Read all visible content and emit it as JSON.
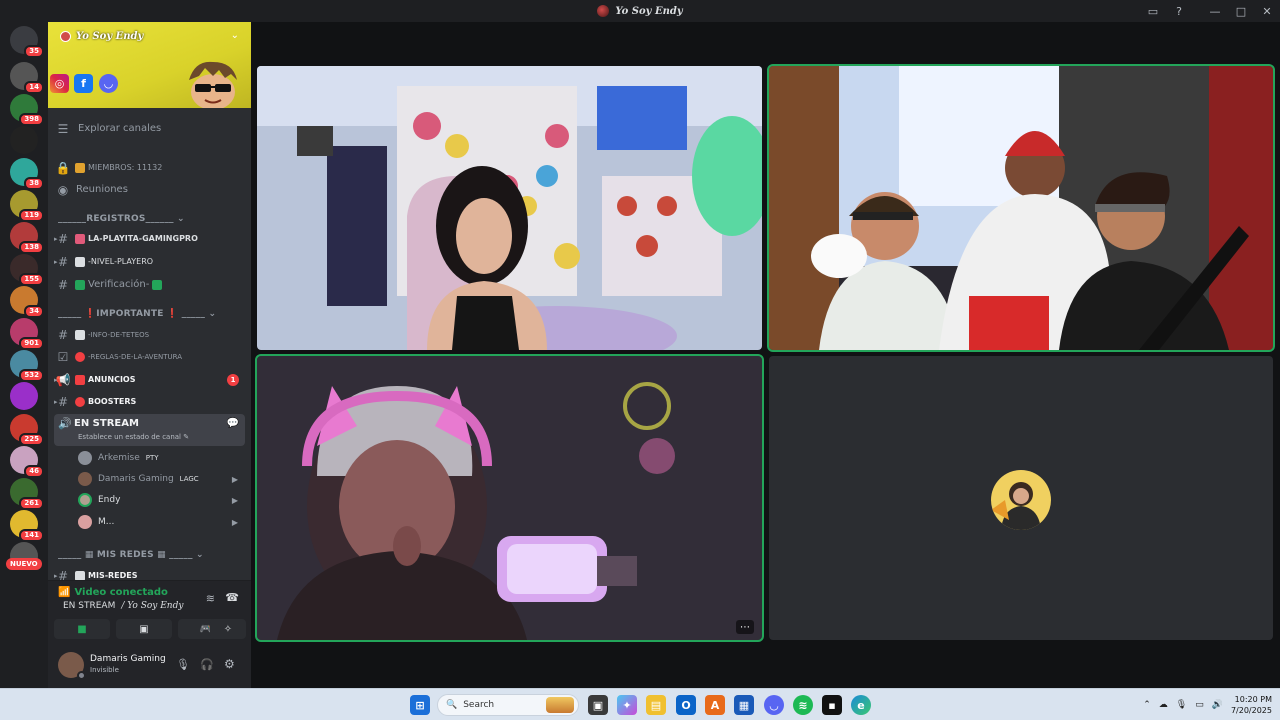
{
  "window": {
    "title": "Yo Soy Endy",
    "controls": [
      "—",
      "□",
      "✕"
    ]
  },
  "servers": [
    {
      "badge": "35",
      "color": "#3a3c41"
    },
    {
      "badge": "14",
      "color": "#555"
    },
    {
      "badge": "398",
      "color": "#2f7a3a"
    },
    {
      "badge": "",
      "color": "#222"
    },
    {
      "badge": "38",
      "color": "#2fa79b"
    },
    {
      "badge": "119",
      "color": "#a79a2f"
    },
    {
      "badge": "138",
      "color": "#b23b3b"
    },
    {
      "badge": "155",
      "color": "#3a2a2a"
    },
    {
      "badge": "34",
      "color": "#c97a2f"
    },
    {
      "badge": "901",
      "color": "#b83c6b"
    },
    {
      "badge": "532",
      "color": "#4a8aa1"
    },
    {
      "badge": "",
      "color": "#9a2fc9"
    },
    {
      "badge": "225",
      "color": "#c93a2f"
    },
    {
      "badge": "46",
      "color": "#c9a2c0"
    },
    {
      "badge": "261",
      "color": "#3a6a2f"
    },
    {
      "badge": "141",
      "color": "#e1b92f"
    },
    {
      "badge": "",
      "color": "#555"
    }
  ],
  "rail": {
    "nuevo": "NUEVO"
  },
  "server": {
    "name": "Yo Soy Endy",
    "explore": "Explorar canales",
    "members": "MIEMBROS: 11132",
    "reuniones": "Reuniones"
  },
  "categories": {
    "registros": "REGISTROS",
    "importante": "IMPORTANTE",
    "mis_redes": "MIS REDES"
  },
  "channels": {
    "c1": "LA-PLAYITA-GAMINGPRO",
    "c2": "-NIVEL-PLAYERO",
    "c3": "Verificación-",
    "c4": "-INFO-DE-TETEOS",
    "c5": "-REGLAS-DE-LA-AVENTURA",
    "c6": "ANUNCIOS",
    "c6_badge": "1",
    "c7": "BOOSTERS",
    "stream": "EN STREAM",
    "stream_status": "Establece un estado de canal",
    "c8": "MIS-REDES"
  },
  "voice_users": [
    {
      "name": "Arkemise",
      "tag": "PTY"
    },
    {
      "name": "Damaris Gaming",
      "tag": "LAGC"
    },
    {
      "name": "Endy",
      "tag": ""
    },
    {
      "name": "M...",
      "tag": ""
    }
  ],
  "voice": {
    "status": "Video conectado",
    "location_channel": "EN STREAM",
    "location_server": "/ Yo Soy Endy"
  },
  "user": {
    "name": "Damaris Gaming",
    "status": "Invisible"
  },
  "taskbar": {
    "search_placeholder": "Search",
    "time": "10:20 PM",
    "date": "7/20/2025"
  },
  "colors": {
    "accent_green": "#23a55a",
    "danger": "#f23f42",
    "sidebar": "#2b2d31",
    "rail": "#1e1f22"
  }
}
